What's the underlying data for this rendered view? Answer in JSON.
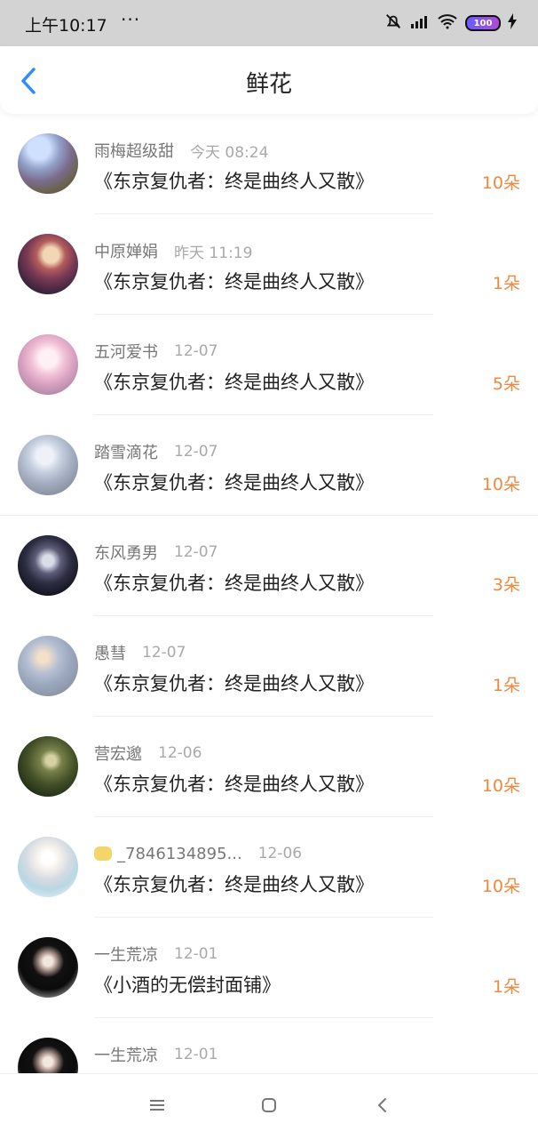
{
  "status_bar": {
    "time": "上午10:17",
    "dots": "···",
    "battery": "100"
  },
  "header": {
    "title": "鲜花"
  },
  "colors": {
    "accent": "#2f8cff",
    "count": "#f0883e",
    "status_bg": "#d3d3d3"
  },
  "entries": [
    {
      "username": "雨梅超级甜",
      "time": "今天 08:24",
      "title": "《东京复仇者：终是曲终人又散》",
      "count": "10朵",
      "avatar": "castle-scene"
    },
    {
      "username": "中原婵娟",
      "time": "昨天 11:19",
      "title": "《东京复仇者：终是曲终人又散》",
      "count": "1朵",
      "avatar": "anime-girl-red"
    },
    {
      "username": "五河爱书",
      "time": "12-07",
      "title": "《东京复仇者：终是曲终人又散》",
      "count": "5朵",
      "avatar": "anime-girl-pink"
    },
    {
      "username": "踏雪滴花",
      "time": "12-07",
      "title": "《东京复仇者：终是曲终人又散》",
      "count": "10朵",
      "avatar": "grey-portrait"
    },
    {
      "username": "东风勇男",
      "time": "12-07",
      "title": "《东京复仇者：终是曲终人又散》",
      "count": "3朵",
      "avatar": "anime-boy-dark"
    },
    {
      "username": "愚彗",
      "time": "12-07",
      "title": "《东京复仇者：终是曲终人又散》",
      "count": "1朵",
      "avatar": "foggy-scene"
    },
    {
      "username": "营宏邈",
      "time": "12-06",
      "title": "《东京复仇者：终是曲终人又散》",
      "count": "10朵",
      "avatar": "hummingbird"
    },
    {
      "username": "_7846134895...",
      "time": "12-06",
      "title": "《东京复仇者：终是曲终人又散》",
      "count": "10朵",
      "avatar": "girl-portrait-light"
    },
    {
      "username": "一生荒凉",
      "time": "12-01",
      "title": "《小酒的无偿封面铺》",
      "count": "1朵",
      "avatar": "anime-man-black-hair"
    },
    {
      "username": "一生荒凉",
      "time": "12-01",
      "title": "",
      "count": "",
      "avatar": "anime-man-black-hair"
    }
  ],
  "nav": {
    "icons": [
      "menu-icon",
      "home-icon",
      "back-icon"
    ]
  }
}
